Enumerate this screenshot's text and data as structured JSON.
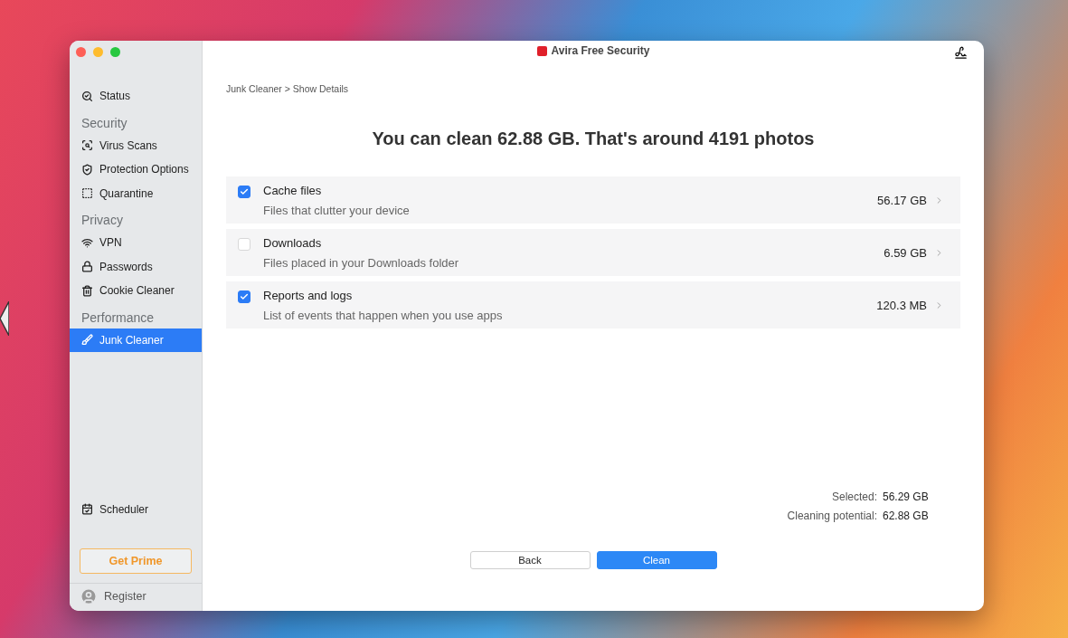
{
  "window": {
    "title": "Avira Free Security"
  },
  "sidebar": {
    "items": [
      {
        "kind": "item",
        "label": "Status",
        "selected": false
      },
      {
        "kind": "section",
        "label": "Security"
      },
      {
        "kind": "item",
        "label": "Virus Scans",
        "selected": false
      },
      {
        "kind": "item",
        "label": "Protection Options",
        "selected": false
      },
      {
        "kind": "item",
        "label": "Quarantine",
        "selected": false
      },
      {
        "kind": "section",
        "label": "Privacy"
      },
      {
        "kind": "item",
        "label": "VPN",
        "selected": false
      },
      {
        "kind": "item",
        "label": "Passwords",
        "selected": false
      },
      {
        "kind": "item",
        "label": "Cookie Cleaner",
        "selected": false
      },
      {
        "kind": "section",
        "label": "Performance"
      },
      {
        "kind": "item",
        "label": "Junk Cleaner",
        "selected": true
      }
    ],
    "bottom_items": [
      {
        "kind": "item",
        "label": "Scheduler",
        "selected": false
      }
    ],
    "get_prime": "Get Prime",
    "register": "Register"
  },
  "breadcrumb": "Junk Cleaner > Show Details",
  "headline": "You can clean 62.88 GB. That's around 4191 photos",
  "categories": [
    {
      "name": "Cache files",
      "description": "Files that clutter your device",
      "size": "56.17 GB",
      "checked": true
    },
    {
      "name": "Downloads",
      "description": "Files placed in your Downloads folder",
      "size": "6.59 GB",
      "checked": false
    },
    {
      "name": "Reports and logs",
      "description": "List of events that happen when you use apps",
      "size": "120.3 MB",
      "checked": true
    }
  ],
  "summary": [
    {
      "label": "Selected:",
      "value": "56.29 GB"
    },
    {
      "label": "Cleaning potential:",
      "value": "62.88 GB"
    }
  ],
  "buttons": [
    {
      "kind": "secondary",
      "label": "Back"
    },
    {
      "kind": "primary",
      "label": "Clean"
    }
  ]
}
